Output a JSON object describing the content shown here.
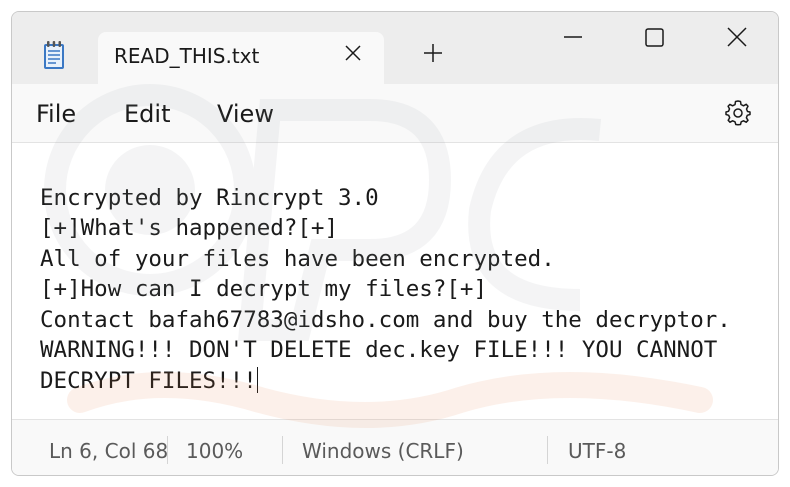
{
  "window": {
    "app_icon": "notepad-icon",
    "tab_title": "READ_THIS.txt",
    "tab_close_icon": "close-icon",
    "new_tab_icon": "plus-icon",
    "controls": [
      "minimize-icon",
      "maximize-icon",
      "close-icon"
    ]
  },
  "menu": {
    "items": [
      "File",
      "Edit",
      "View"
    ],
    "settings_icon": "gear-icon"
  },
  "editor": {
    "lines": [
      "Encrypted by Rincrypt 3.0",
      "[+]What's happened?[+]",
      "All of your files have been encrypted.",
      "[+]How can I decrypt my files?[+]",
      "Contact bafah67783@idsho.com and buy the decryptor.",
      "WARNING!!! DON'T DELETE dec.key FILE!!! YOU CANNOT",
      "DECRYPT FILES!!!"
    ]
  },
  "status": {
    "position": "Ln 6, Col 68",
    "zoom": "100%",
    "line_ending": "Windows (CRLF)",
    "encoding": "UTF-8"
  },
  "colors": {
    "titlebar": "#ededed",
    "editor_bg": "#ffffff",
    "text": "#1a1a1a",
    "status_text": "#5a5a5a"
  }
}
